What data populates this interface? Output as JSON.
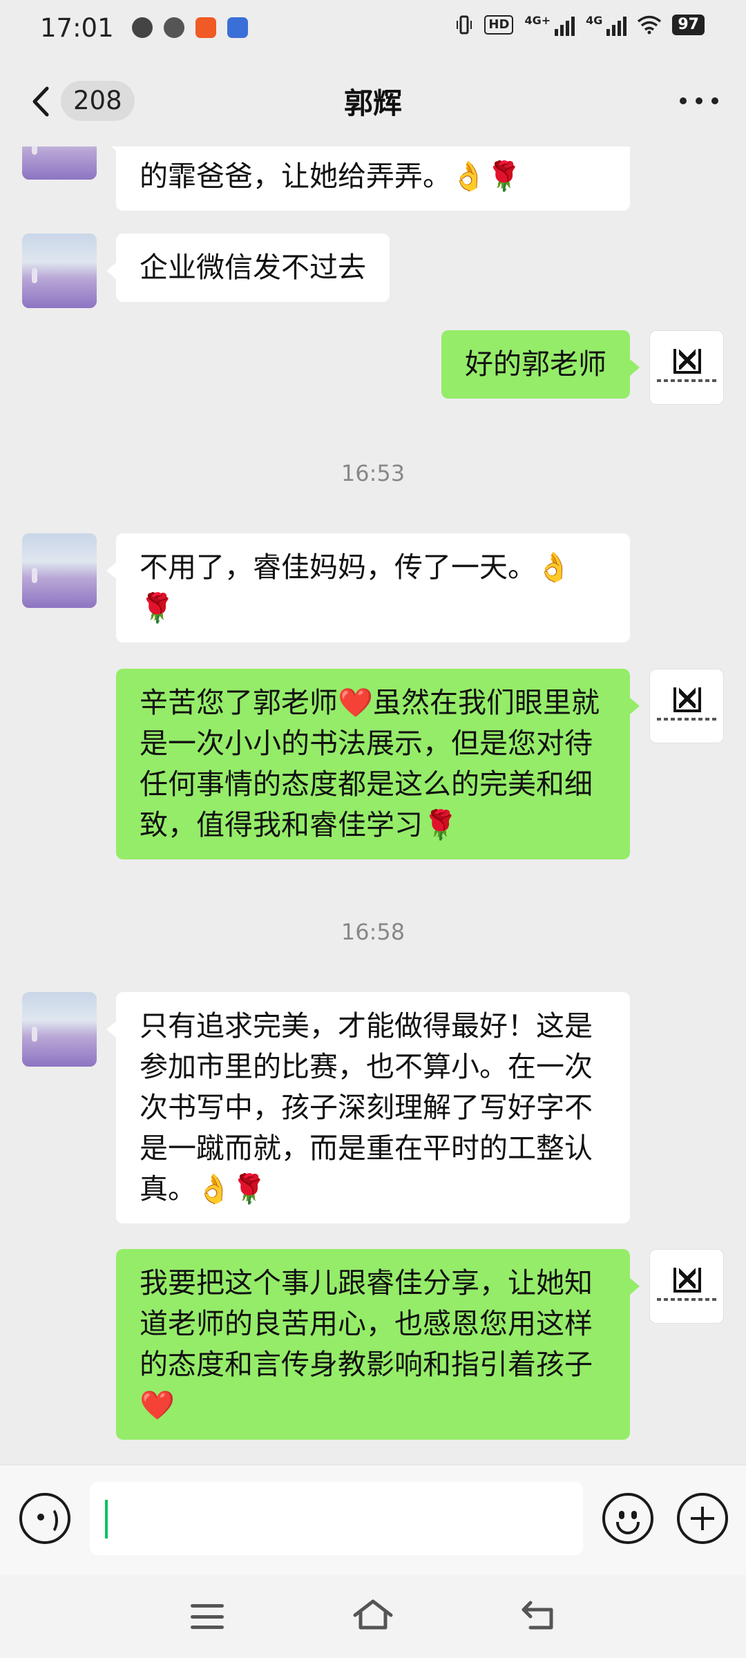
{
  "status_bar": {
    "time": "17:01",
    "hd_label": "HD",
    "signal_1": "4G+",
    "signal_2": "4G",
    "battery": "97"
  },
  "nav": {
    "unread_count": "208",
    "title": "郭辉"
  },
  "messages": [
    {
      "side": "in",
      "text": "的霏爸爸，让她给弄弄。👌🌹"
    },
    {
      "side": "in",
      "text": "企业微信发不过去"
    },
    {
      "side": "out",
      "text": "好的郭老师"
    },
    {
      "time": "16:53"
    },
    {
      "side": "in",
      "text": "不用了，睿佳妈妈，传了一天。👌🌹"
    },
    {
      "side": "out",
      "text": "辛苦您了郭老师❤️虽然在我们眼里就是一次小小的书法展示，但是您对待任何事情的态度都是这么的完美和细致，值得我和睿佳学习🌹"
    },
    {
      "time": "16:58"
    },
    {
      "side": "in",
      "text": "只有追求完美，才能做得最好！这是参加市里的比赛，也不算小。在一次次书写中，孩子深刻理解了写好字不是一蹴而就，而是重在平时的工整认真。👌🌹"
    },
    {
      "side": "out",
      "text": "我要把这个事儿跟睿佳分享，让她知道老师的良苦用心，也感恩您用这样的态度和言传身教影响和指引着孩子❤️"
    }
  ],
  "input": {
    "value": "",
    "placeholder": ""
  },
  "colors": {
    "outgoing_bubble": "#95ec69",
    "incoming_bubble": "#ffffff",
    "background": "#ededed",
    "caret": "#07c160"
  },
  "icons": [
    "back-arrow-icon",
    "more-icon",
    "voice-icon",
    "emoji-icon",
    "plus-icon",
    "menu-icon",
    "home-icon",
    "back-icon"
  ]
}
